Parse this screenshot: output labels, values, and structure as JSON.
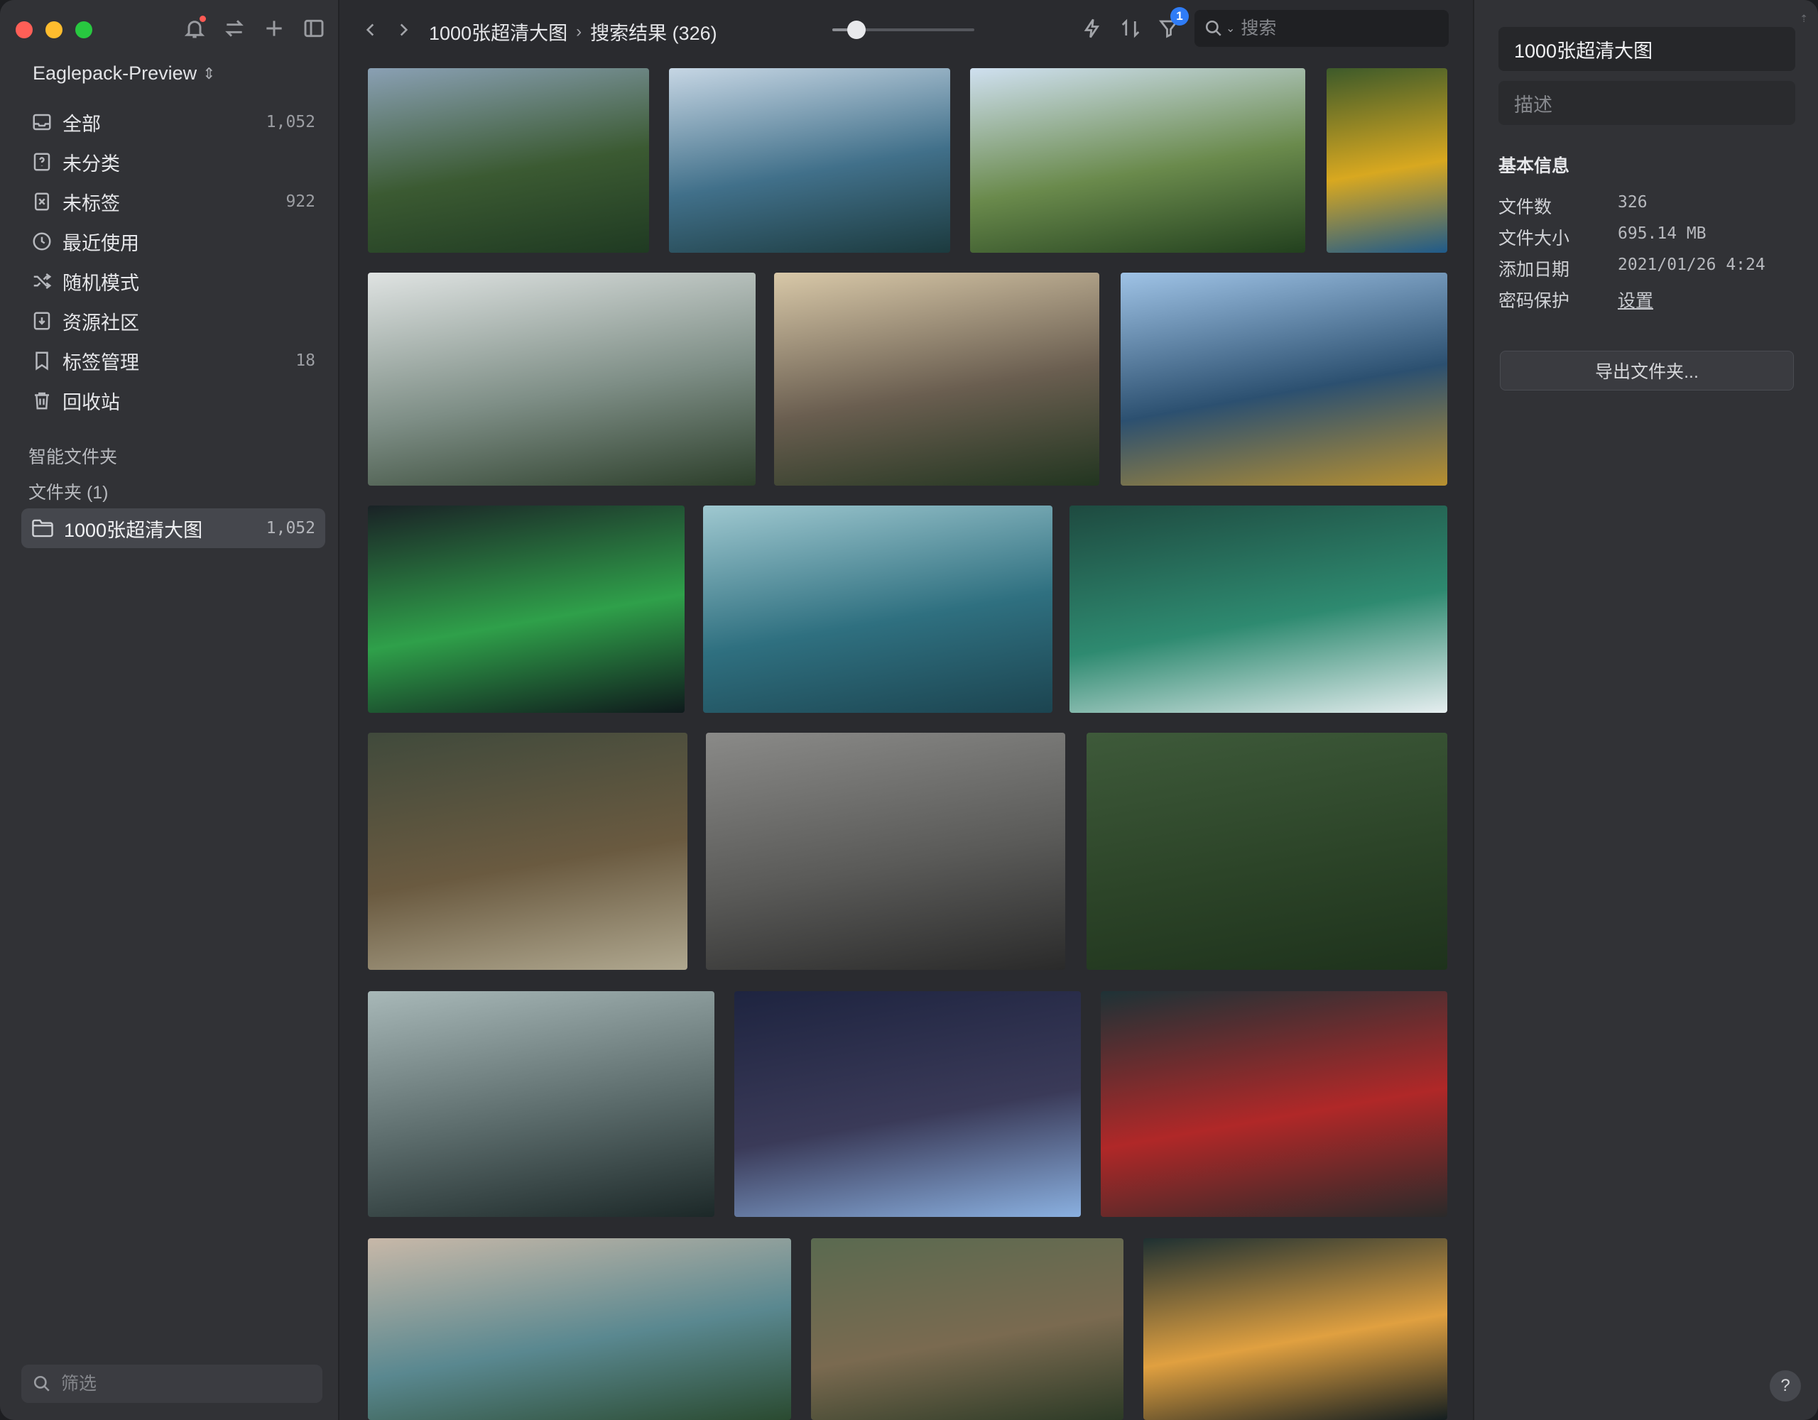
{
  "sidebar": {
    "library_name": "Eaglepack-Preview",
    "nav_items": [
      {
        "label": "全部",
        "count": "1,052",
        "icon": "inbox-icon"
      },
      {
        "label": "未分类",
        "count": "",
        "icon": "question-box-icon"
      },
      {
        "label": "未标签",
        "count": "922",
        "icon": "untagged-icon"
      },
      {
        "label": "最近使用",
        "count": "",
        "icon": "clock-icon"
      },
      {
        "label": "随机模式",
        "count": "",
        "icon": "shuffle-icon"
      },
      {
        "label": "资源社区",
        "count": "",
        "icon": "download-box-icon"
      },
      {
        "label": "标签管理",
        "count": "18",
        "icon": "bookmark-icon"
      },
      {
        "label": "回收站",
        "count": "",
        "icon": "trash-icon"
      }
    ],
    "smart_folders_title": "智能文件夹",
    "folders_title": "文件夹 (1)",
    "folder": {
      "label": "1000张超清大图",
      "count": "1,052"
    },
    "filter_placeholder": "筛选"
  },
  "toolbar": {
    "breadcrumb_folder": "1000张超清大图",
    "breadcrumb_sep": "›",
    "breadcrumb_result": "搜索结果 (326)",
    "zoom_level": 0.17,
    "filter_badge": "1",
    "search_placeholder": "搜索"
  },
  "thumbnails": [
    {
      "name": "coastal-forest-road",
      "colors": [
        "#8aa0b4",
        "#3b5a32",
        "#1f3a22"
      ]
    },
    {
      "name": "sea-stacks-aerial",
      "colors": [
        "#c6d6e4",
        "#41708a",
        "#1c3a3e"
      ]
    },
    {
      "name": "green-mountain-valley",
      "colors": [
        "#cfe0f0",
        "#6a8a4c",
        "#22401e"
      ]
    },
    {
      "name": "macaw-parrot",
      "colors": [
        "#3d5a2a",
        "#d8a820",
        "#1f5a8a"
      ]
    },
    {
      "name": "misty-valley-prayer-flags",
      "colors": [
        "#dfe3e2",
        "#7e8e86",
        "#2c3e2a"
      ]
    },
    {
      "name": "sunlit-mountain-range",
      "colors": [
        "#d8c8a8",
        "#6a5e50",
        "#223520"
      ]
    },
    {
      "name": "golden-grass-ocean",
      "colors": [
        "#9fc3e6",
        "#2c5070",
        "#b89030"
      ]
    },
    {
      "name": "green-aurora",
      "colors": [
        "#1a2226",
        "#2fa04a",
        "#0f1a1c"
      ]
    },
    {
      "name": "ocean-wave-aerial",
      "colors": [
        "#9fc8d0",
        "#2f7080",
        "#1c4450"
      ]
    },
    {
      "name": "green-sea-wave",
      "colors": [
        "#1e4a40",
        "#2e8a70",
        "#e6eef0"
      ]
    },
    {
      "name": "boardwalk-wetland",
      "colors": [
        "#404a3c",
        "#6a5a40",
        "#b0a890"
      ]
    },
    {
      "name": "wooden-desk-flatlay",
      "colors": [
        "#8a8a88",
        "#5a5a58",
        "#2a2a2a"
      ]
    },
    {
      "name": "pine-forest-aerial",
      "colors": [
        "#3e5a3a",
        "#2c4428",
        "#1e321c"
      ]
    },
    {
      "name": "snowy-mountain-lake",
      "colors": [
        "#a8b8b8",
        "#5a6a6a",
        "#1c2828"
      ]
    },
    {
      "name": "night-teepees",
      "colors": [
        "#1e2440",
        "#3a3a58",
        "#8ab0e0"
      ]
    },
    {
      "name": "red-umbrella-night",
      "colors": [
        "#1e3236",
        "#b02828",
        "#2a2a2a"
      ]
    },
    {
      "name": "lake-mountain-dusk",
      "colors": [
        "#c8b8a8",
        "#5a8890",
        "#2a4a30"
      ]
    },
    {
      "name": "forest-hiker-boots",
      "colors": [
        "#5a6a50",
        "#7a6a50",
        "#2c3a26"
      ]
    },
    {
      "name": "sparkler-dark",
      "colors": [
        "#1e3032",
        "#e0a040",
        "#141e20"
      ]
    }
  ],
  "inspector": {
    "title": "1000张超清大图",
    "description_placeholder": "描述",
    "section_title": "基本信息",
    "rows": [
      {
        "key": "文件数",
        "value": "326"
      },
      {
        "key": "文件大小",
        "value": "695.14 MB"
      },
      {
        "key": "添加日期",
        "value": "2021/01/26 4:24"
      },
      {
        "key": "密码保护",
        "value": "设置"
      }
    ],
    "export_label": "导出文件夹...",
    "help_label": "?"
  }
}
